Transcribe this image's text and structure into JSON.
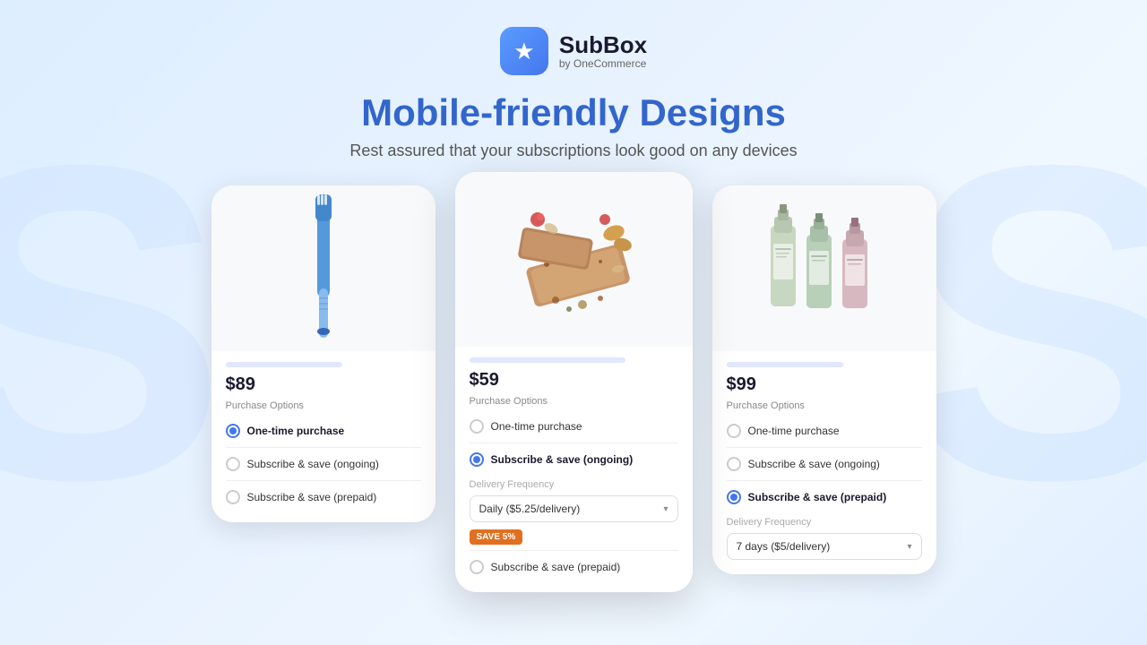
{
  "logo": {
    "icon": "★",
    "title": "SubBox",
    "subtitle": "by OneCommerce"
  },
  "heading": {
    "main": "Mobile-friendly Designs",
    "sub": "Rest assured that your subscriptions look good on any devices"
  },
  "cards": [
    {
      "id": "card-left",
      "product": "toothbrush",
      "price": "$89",
      "purchase_options_label": "Purchase Options",
      "options": [
        {
          "label": "One-time purchase",
          "selected": true
        },
        {
          "label": "Subscribe & save (ongoing)",
          "selected": false
        },
        {
          "label": "Subscribe & save (prepaid)",
          "selected": false
        }
      ],
      "show_delivery": false
    },
    {
      "id": "card-center",
      "product": "food",
      "price": "$59",
      "purchase_options_label": "Purchase Options",
      "options": [
        {
          "label": "One-time purchase",
          "selected": false
        },
        {
          "label": "Subscribe & save (ongoing)",
          "selected": true
        },
        {
          "label": "Subscribe & save (prepaid)",
          "selected": false
        }
      ],
      "show_delivery": true,
      "delivery_label": "Delivery Frequency",
      "delivery_value": "Daily ($5.25/delivery)",
      "save_badge": "SAVE 5%"
    },
    {
      "id": "card-right",
      "product": "bottles",
      "price": "$99",
      "purchase_options_label": "Purchase Options",
      "options": [
        {
          "label": "One-time purchase",
          "selected": false
        },
        {
          "label": "Subscribe & save (ongoing)",
          "selected": false
        },
        {
          "label": "Subscribe & save (prepaid)",
          "selected": true
        }
      ],
      "show_delivery": true,
      "delivery_label": "Delivery Frequency",
      "delivery_value": "7 days ($5/delivery)"
    }
  ],
  "watermark": "S"
}
